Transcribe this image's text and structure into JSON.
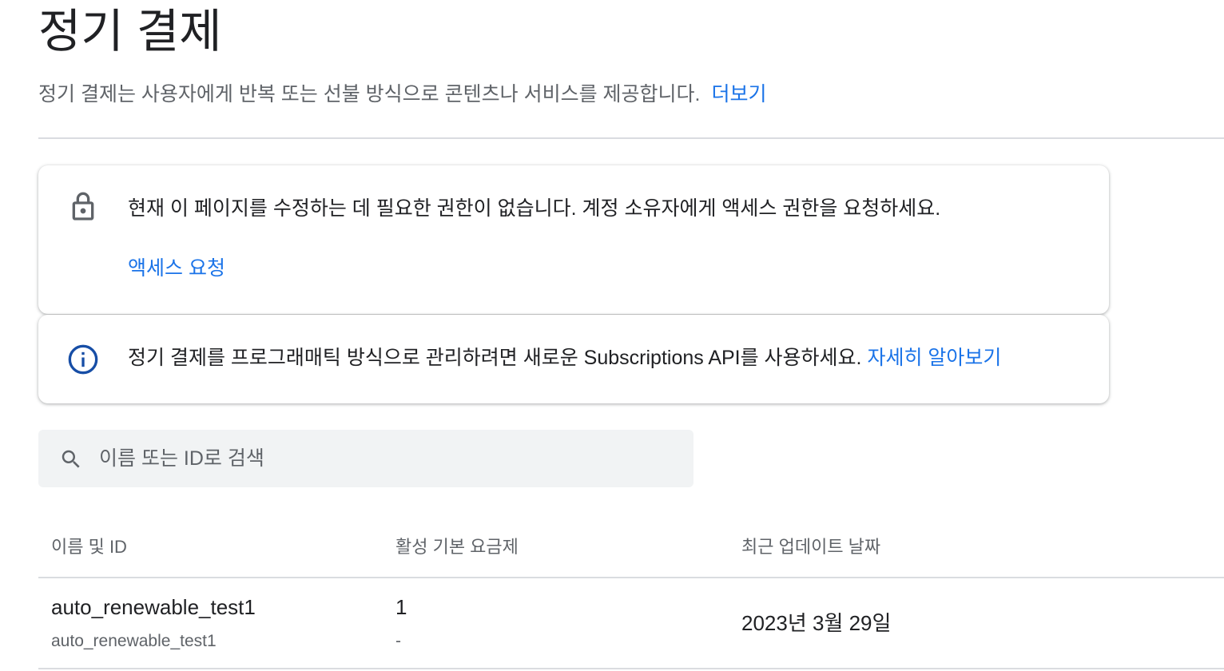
{
  "header": {
    "title": "정기 결제",
    "subtitle": "정기 결제는 사용자에게 반복 또는 선불 방식으로 콘텐츠나 서비스를 제공합니다.",
    "learn_more_link": "더보기"
  },
  "permission_card": {
    "icon": "lock-icon",
    "message": "현재 이 페이지를 수정하는 데 필요한 권한이 없습니다. 계정 소유자에게 액세스 권한을 요청하세요.",
    "action_label": "액세스 요청"
  },
  "api_card": {
    "icon": "info-icon",
    "message": "정기 결제를 프로그래매틱 방식으로 관리하려면 새로운 Subscriptions API를 사용하세요.",
    "link_label": "자세히 알아보기"
  },
  "search": {
    "icon": "search-icon",
    "placeholder": "이름 또는 ID로 검색",
    "value": ""
  },
  "table": {
    "columns": [
      "이름 및 ID",
      "활성 기본 요금제",
      "최근 업데이트 날짜"
    ],
    "rows": [
      {
        "name": "auto_renewable_test1",
        "id": "auto_renewable_test1",
        "active_base_plans": "1",
        "active_base_plans_sub": "-",
        "last_updated": "2023년 3월 29일"
      }
    ]
  },
  "colors": {
    "link": "#1a73e8",
    "info_icon": "#174ea6",
    "lock_icon": "#5f6368",
    "text_primary": "#202124",
    "text_secondary": "#5f6368",
    "divider": "#dadce0",
    "search_bg": "#f1f3f4"
  }
}
